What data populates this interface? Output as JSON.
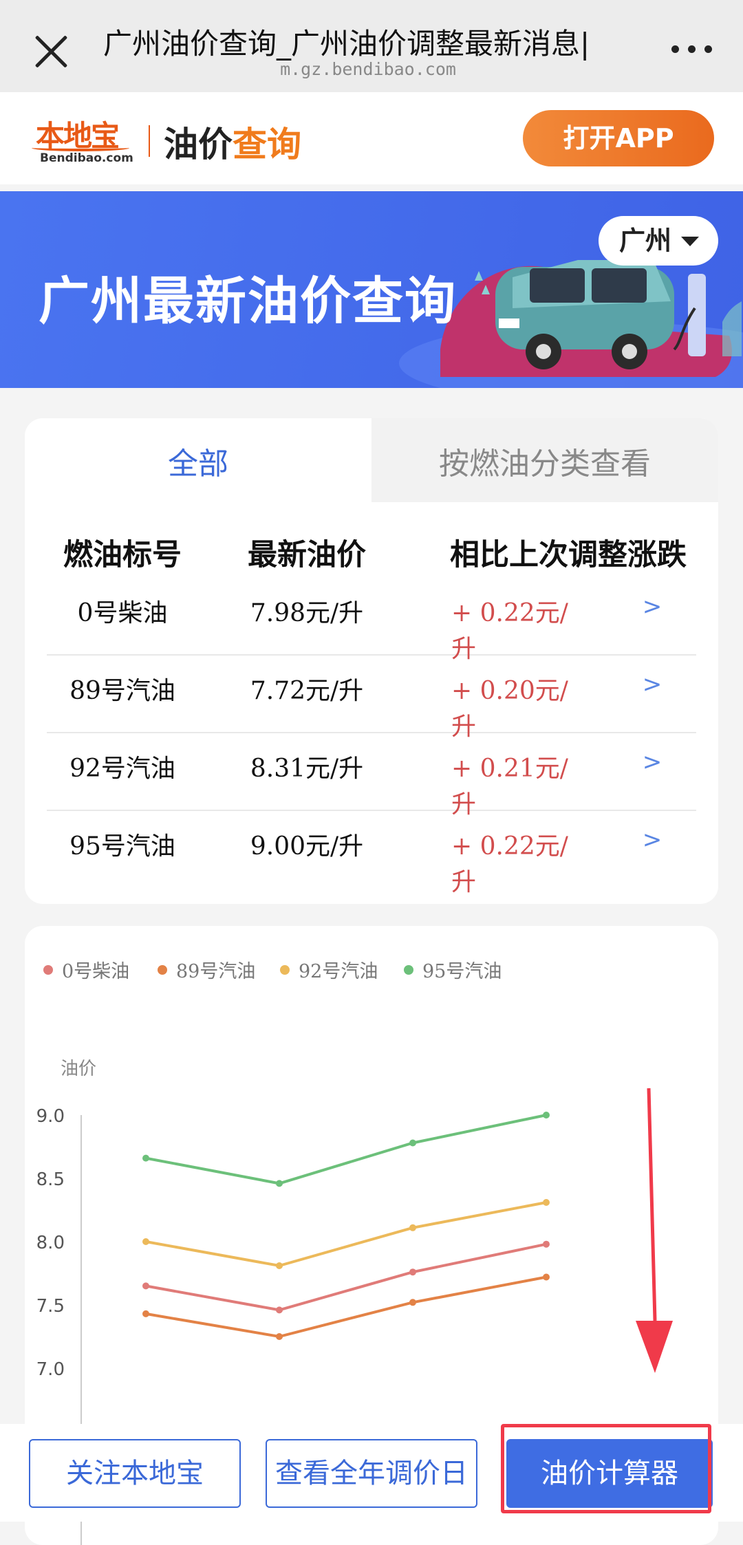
{
  "browser": {
    "title": "广州油价查询_广州油价调整最新消息|",
    "url": "m.gz.bendibao.com"
  },
  "header": {
    "logo_cn": "本地宝",
    "logo_en": "Bendibao.com",
    "title_a": "油价",
    "title_b": "查询",
    "open_app": "打开APP"
  },
  "banner": {
    "title": "广州最新油价查询",
    "city": "广州"
  },
  "tabs": {
    "all": "全部",
    "by_category": "按燃油分类查看"
  },
  "table": {
    "headers": [
      "燃油标号",
      "最新油价",
      "相比上次调整涨跌"
    ],
    "rows": [
      {
        "name": "0号柴油",
        "price": "7.98元/升",
        "change": "+ 0.22元/升",
        "arrow": ">"
      },
      {
        "name": "89号汽油",
        "price": "7.72元/升",
        "change": "+ 0.20元/升",
        "arrow": ">"
      },
      {
        "name": "92号汽油",
        "price": "8.31元/升",
        "change": "+ 0.21元/升",
        "arrow": ">"
      },
      {
        "name": "95号汽油",
        "price": "9.00元/升",
        "change": "+ 0.22元/升",
        "arrow": ">"
      }
    ]
  },
  "colors": {
    "diesel0": "#e07b78",
    "gas89": "#e38246",
    "gas92": "#ecb95a",
    "gas95": "#6cc07a",
    "accent": "#3f6de3",
    "highlight": "#f03a4a"
  },
  "chart_data": {
    "type": "line",
    "ylabel": "油价",
    "yticks": [
      "9.0",
      "8.5",
      "8.0",
      "7.5",
      "7.0"
    ],
    "ylim": [
      6.5,
      9.0
    ],
    "x": [
      1,
      2,
      3,
      4
    ],
    "grid": false,
    "legend_position": "top-left",
    "series": [
      {
        "name": "0号柴油",
        "color": "#e07b78",
        "values": [
          7.65,
          7.46,
          7.76,
          7.98
        ]
      },
      {
        "name": "89号汽油",
        "color": "#e38246",
        "values": [
          7.43,
          7.25,
          7.52,
          7.72
        ]
      },
      {
        "name": "92号汽油",
        "color": "#ecb95a",
        "values": [
          8.0,
          7.81,
          8.11,
          8.31
        ]
      },
      {
        "name": "95号汽油",
        "color": "#6cc07a",
        "values": [
          8.66,
          8.46,
          8.78,
          9.0
        ]
      }
    ]
  },
  "bottom": {
    "follow": "关注本地宝",
    "calendar": "查看全年调价日",
    "calculator": "油价计算器"
  }
}
